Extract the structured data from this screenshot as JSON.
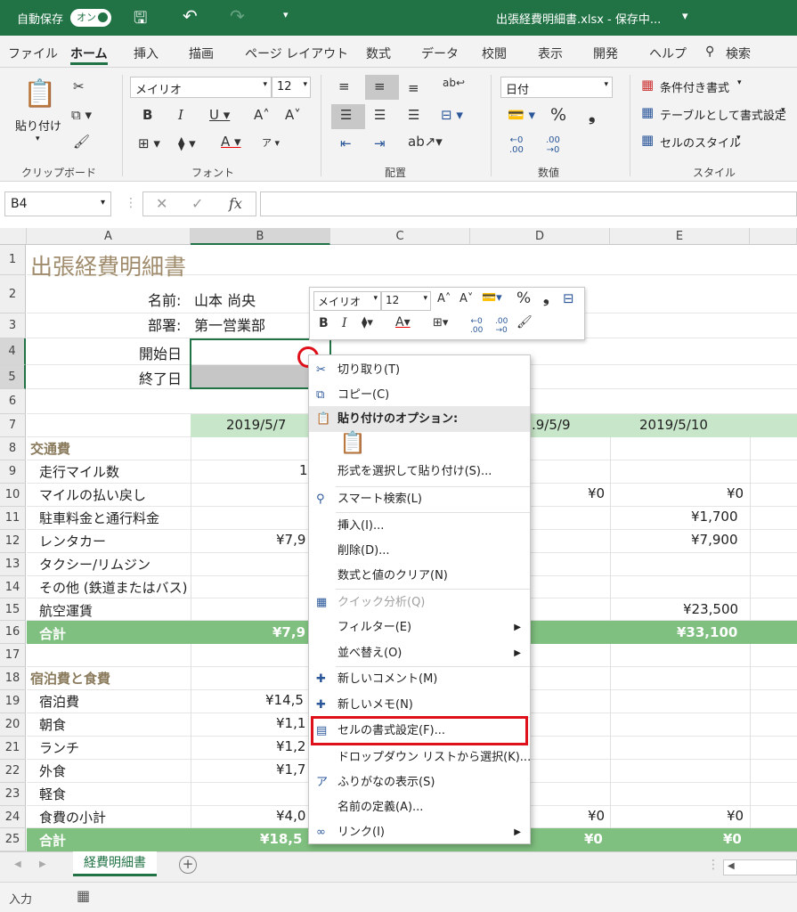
{
  "titlebar": {
    "autosave": "自動保存",
    "toggle": "オン",
    "doc_title": "出張経費明細書.xlsx - 保存中...",
    "dropdown": "▾"
  },
  "tabs": [
    "ファイル",
    "ホーム",
    "挿入",
    "描画",
    "ページ レイアウト",
    "数式",
    "データ",
    "校閲",
    "表示",
    "開発",
    "ヘルプ"
  ],
  "search": "検索",
  "ribbon": {
    "paste_label": "貼り付け",
    "groups": {
      "clipboard": "クリップボード",
      "font": "フォント",
      "alignment": "配置",
      "number": "数値",
      "style": "スタイル"
    },
    "font_name": "メイリオ",
    "font_size": "12",
    "number_format": "日付",
    "conditional": "条件付き書式",
    "table_format": "テーブルとして書式設定",
    "cell_style": "セルのスタイル"
  },
  "formula_bar": {
    "name_box": "B4",
    "fx": "fx",
    "value": ""
  },
  "columns": [
    "A",
    "B",
    "C",
    "D",
    "E"
  ],
  "rows": [
    "1",
    "2",
    "3",
    "4",
    "5",
    "6",
    "7",
    "8",
    "9",
    "10",
    "11",
    "12",
    "13",
    "14",
    "15",
    "16",
    "17",
    "18",
    "19",
    "20",
    "21",
    "22",
    "23",
    "24",
    "25"
  ],
  "sheet": {
    "title": "出張経費明細書",
    "name_label": "名前:",
    "name_value": "山本 尚央",
    "dept_label": "部署:",
    "dept_value": "第一営業部",
    "start_label": "開始日",
    "end_label": "終了日",
    "dates": [
      "2019/5/7",
      ".9/5/9",
      "2019/5/10"
    ],
    "transport": "交通費",
    "transport_items": [
      "走行マイル数",
      "マイルの払い戻し",
      "駐車料金と通行料金",
      "レンタカー",
      "タクシー/リムジン",
      "その他 (鉄道またはバス)",
      "航空運賃"
    ],
    "b9": "1",
    "b12": "¥7,9",
    "d10": "¥0",
    "e10": "¥0",
    "e11": "¥1,700",
    "e12": "¥7,900",
    "e15": "¥23,500",
    "total": "合計",
    "b16": "¥7,9",
    "e16": "¥33,100",
    "lodging": "宿泊費と食費",
    "lodging_items": [
      "宿泊費",
      "朝食",
      "ランチ",
      "外食",
      "軽食",
      "食費の小計"
    ],
    "b19": "¥14,5",
    "b20": "¥1,1",
    "b21": "¥1,2",
    "b22": "¥1,7",
    "b24": "¥4,0",
    "d24": "¥0",
    "e24": "¥0",
    "b25": "¥18,5",
    "d25": "¥0",
    "e25": "¥0"
  },
  "mini_toolbar": {
    "font": "メイリオ",
    "size": "12",
    "percent": "%",
    "comma": "❟"
  },
  "context_menu": [
    {
      "label": "切り取り(T)",
      "icon": "✂"
    },
    {
      "label": "コピー(C)",
      "icon": "⧉"
    },
    {
      "label": "貼り付けのオプション:",
      "icon": "📋"
    },
    {
      "label": "形式を選択して貼り付け(S)...",
      "icon": ""
    },
    {
      "label": "スマート検索(L)",
      "icon": "⚲"
    },
    {
      "label": "挿入(I)...",
      "icon": ""
    },
    {
      "label": "削除(D)...",
      "icon": ""
    },
    {
      "label": "数式と値のクリア(N)",
      "icon": ""
    },
    {
      "label": "クイック分析(Q)",
      "icon": "▦"
    },
    {
      "label": "フィルター(E)",
      "icon": ""
    },
    {
      "label": "並べ替え(O)",
      "icon": ""
    },
    {
      "label": "新しいコメント(M)",
      "icon": "✚"
    },
    {
      "label": "新しいメモ(N)",
      "icon": "✚"
    },
    {
      "label": "セルの書式設定(F)...",
      "icon": "▤"
    },
    {
      "label": "ドロップダウン リストから選択(K)...",
      "icon": ""
    },
    {
      "label": "ふりがなの表示(S)",
      "icon": "ア"
    },
    {
      "label": "名前の定義(A)...",
      "icon": ""
    },
    {
      "label": "リンク(I)",
      "icon": "∞"
    }
  ],
  "sheet_tab": "経費明細書",
  "status": "入力",
  "colors": {
    "excel_green": "#217346",
    "highlight_red": "#e0101a",
    "table_green": "#7fbf7f"
  }
}
